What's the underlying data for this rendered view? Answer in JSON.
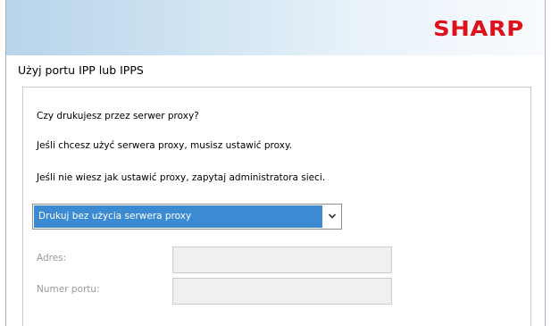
{
  "header": {
    "brand": "SHARP",
    "brand_color": "#e0101b"
  },
  "page": {
    "title": "Użyj portu IPP lub IPPS"
  },
  "panel": {
    "question": "Czy drukujesz przez serwer proxy?",
    "info1": "Jeśli chcesz użyć serwera proxy, musisz ustawić proxy.",
    "info2": "Jeśli nie wiesz jak ustawić proxy, zapytaj administratora sieci.",
    "proxy_select": {
      "selected": "Drukuj bez użycia serwera proxy",
      "icon": "chevron-down-icon",
      "selected_bg": "#3c8ad2"
    },
    "address": {
      "label": "Adres:",
      "value": "",
      "enabled": false
    },
    "port": {
      "label": "Numer portu:",
      "value": "",
      "enabled": false
    }
  }
}
